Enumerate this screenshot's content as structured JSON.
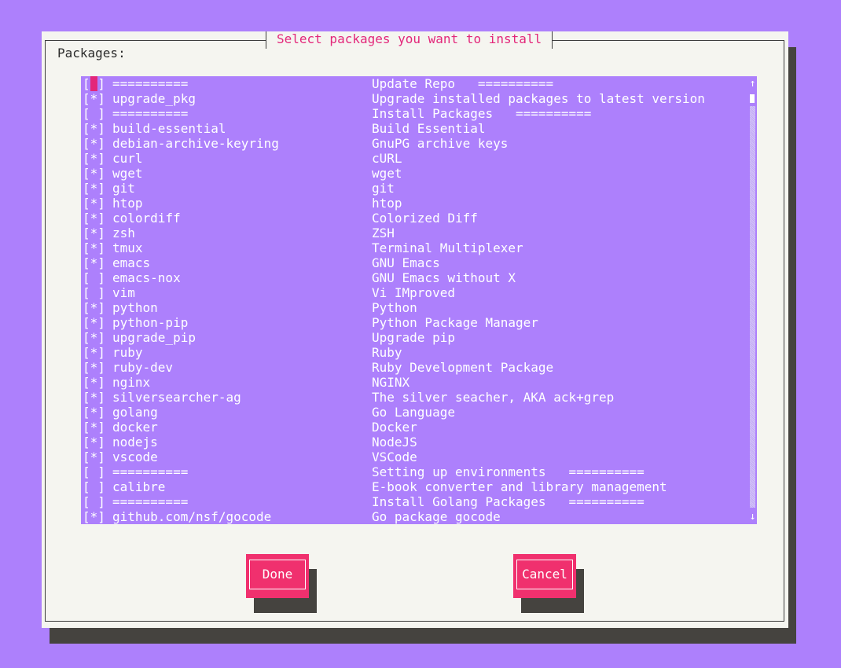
{
  "dialog": {
    "title": "Select packages you want to install",
    "label": "Packages:"
  },
  "packages": [
    {
      "check": "[ ]",
      "name": "==========",
      "desc": "Update Repo   =========="
    },
    {
      "check": "[*]",
      "name": "upgrade_pkg",
      "desc": "Upgrade installed packages to latest version"
    },
    {
      "check": "[ ]",
      "name": "==========",
      "desc": "Install Packages   =========="
    },
    {
      "check": "[*]",
      "name": "build-essential",
      "desc": "Build Essential"
    },
    {
      "check": "[*]",
      "name": "debian-archive-keyring",
      "desc": "GnuPG archive keys"
    },
    {
      "check": "[*]",
      "name": "curl",
      "desc": "cURL"
    },
    {
      "check": "[*]",
      "name": "wget",
      "desc": "wget"
    },
    {
      "check": "[*]",
      "name": "git",
      "desc": "git"
    },
    {
      "check": "[*]",
      "name": "htop",
      "desc": "htop"
    },
    {
      "check": "[*]",
      "name": "colordiff",
      "desc": "Colorized Diff"
    },
    {
      "check": "[*]",
      "name": "zsh",
      "desc": "ZSH"
    },
    {
      "check": "[*]",
      "name": "tmux",
      "desc": "Terminal Multiplexer"
    },
    {
      "check": "[*]",
      "name": "emacs",
      "desc": "GNU Emacs"
    },
    {
      "check": "[ ]",
      "name": "emacs-nox",
      "desc": "GNU Emacs without X"
    },
    {
      "check": "[ ]",
      "name": "vim",
      "desc": "Vi IMproved"
    },
    {
      "check": "[*]",
      "name": "python",
      "desc": "Python"
    },
    {
      "check": "[*]",
      "name": "python-pip",
      "desc": "Python Package Manager"
    },
    {
      "check": "[*]",
      "name": "upgrade_pip",
      "desc": "Upgrade pip"
    },
    {
      "check": "[*]",
      "name": "ruby",
      "desc": "Ruby"
    },
    {
      "check": "[*]",
      "name": "ruby-dev",
      "desc": "Ruby Development Package"
    },
    {
      "check": "[*]",
      "name": "nginx",
      "desc": "NGINX"
    },
    {
      "check": "[*]",
      "name": "silversearcher-ag",
      "desc": "The silver seacher, AKA ack+grep"
    },
    {
      "check": "[*]",
      "name": "golang",
      "desc": "Go Language"
    },
    {
      "check": "[*]",
      "name": "docker",
      "desc": "Docker"
    },
    {
      "check": "[*]",
      "name": "nodejs",
      "desc": "NodeJS"
    },
    {
      "check": "[*]",
      "name": "vscode",
      "desc": "VSCode"
    },
    {
      "check": "[ ]",
      "name": "==========",
      "desc": "Setting up environments   =========="
    },
    {
      "check": "[ ]",
      "name": "calibre",
      "desc": "E-book converter and library management"
    },
    {
      "check": "[ ]",
      "name": "==========",
      "desc": "Install Golang Packages   =========="
    },
    {
      "check": "[*]",
      "name": "github.com/nsf/gocode",
      "desc": "Go package gocode"
    }
  ],
  "scrollbar": {
    "up_glyph": "↑",
    "down_glyph": "↓"
  },
  "buttons": {
    "done_label": "Done",
    "cancel_label": "Cancel"
  },
  "colors": {
    "background": "#ad80fc",
    "dialog": "#f5f5f0",
    "accent": "#e3277a",
    "button": "#f0306e",
    "shadow": "#45433f"
  }
}
